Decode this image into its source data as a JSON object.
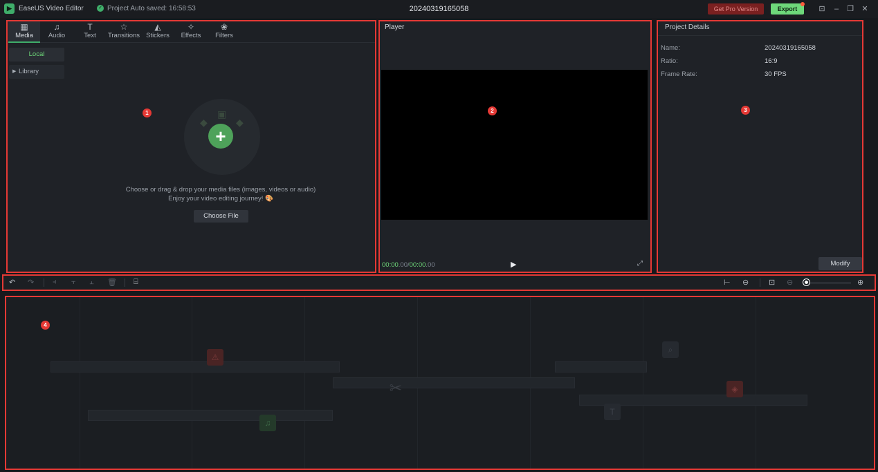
{
  "titlebar": {
    "app_name": "EaseUS Video Editor",
    "autosave": "Project Auto saved: 16:58:53",
    "project_name": "20240319165058",
    "pro_button": "Get Pro Version",
    "export_button": "Export"
  },
  "media": {
    "tabs": [
      {
        "label": "Media",
        "icon": "media-icon"
      },
      {
        "label": "Audio",
        "icon": "audio-icon"
      },
      {
        "label": "Text",
        "icon": "text-icon"
      },
      {
        "label": "Transitions",
        "icon": "transitions-icon"
      },
      {
        "label": "Stickers",
        "icon": "stickers-icon"
      },
      {
        "label": "Effects",
        "icon": "effects-icon"
      },
      {
        "label": "Filters",
        "icon": "filters-icon"
      }
    ],
    "sidebar": {
      "local": "Local",
      "library": "Library"
    },
    "drop_text_1": "Choose or drag & drop your media files (images, videos or audio)",
    "drop_text_2": "Enjoy your video editing journey! 🎨",
    "choose_button": "Choose File"
  },
  "player": {
    "title": "Player",
    "time_current_bold": "00:00",
    "time_current_frac": ".00/",
    "time_total_bold": "00:00",
    "time_total_frac": ".00"
  },
  "details": {
    "title": "Project Details",
    "rows": [
      {
        "label": "Name:",
        "value": "20240319165058"
      },
      {
        "label": "Ratio:",
        "value": "16:9"
      },
      {
        "label": "Frame Rate:",
        "value": "30 FPS"
      }
    ],
    "modify_button": "Modify"
  },
  "markers": [
    "1",
    "2",
    "3",
    "4"
  ],
  "colors": {
    "accent": "#3fae6a",
    "highlight": "#e53935",
    "panel": "#1f2227"
  }
}
